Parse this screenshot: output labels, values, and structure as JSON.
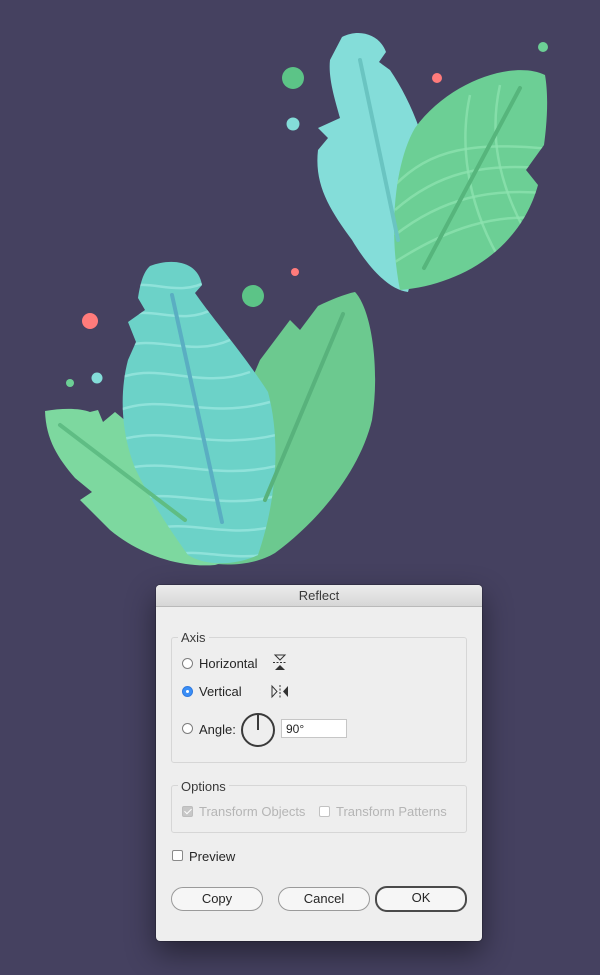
{
  "colors": {
    "background": "#454160",
    "leaf_cyan": "#84ddd9",
    "leaf_green": "#6ccf95",
    "leaf_teal": "#6cd2c8",
    "leaf_mint": "#7dd89f",
    "dot_red": "#ff7b7b"
  },
  "dialog": {
    "title": "Reflect",
    "axis_group": {
      "label": "Axis",
      "horizontal_label": "Horizontal",
      "vertical_label": "Vertical",
      "angle_label": "Angle:",
      "angle_value": "90°",
      "selected": "vertical"
    },
    "options_group": {
      "label": "Options",
      "transform_objects_label": "Transform Objects",
      "transform_patterns_label": "Transform Patterns",
      "transform_objects_checked": true,
      "transform_patterns_checked": false,
      "enabled": false
    },
    "preview_label": "Preview",
    "preview_checked": false,
    "buttons": {
      "copy": "Copy",
      "cancel": "Cancel",
      "ok": "OK"
    }
  }
}
